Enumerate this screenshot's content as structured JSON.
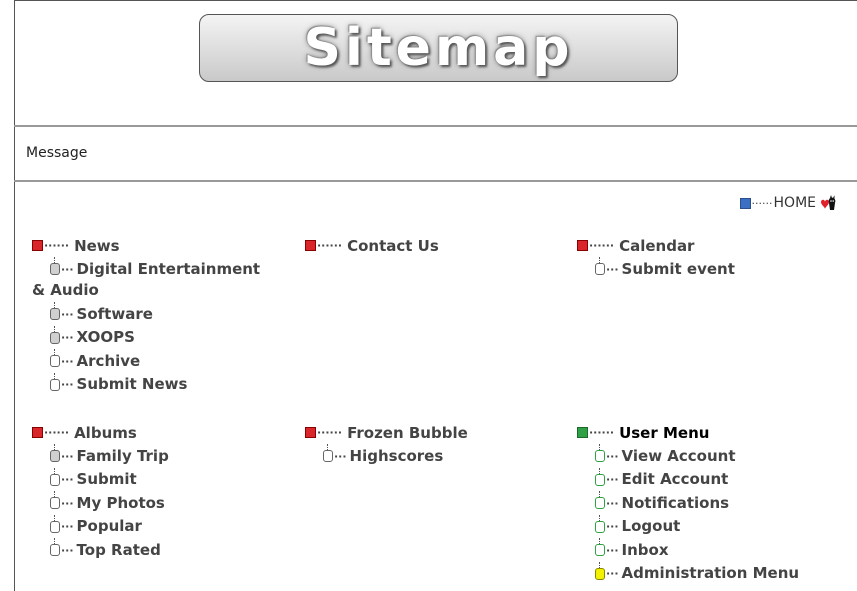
{
  "logo": {
    "text": "Sitemap"
  },
  "message": "Message",
  "home": {
    "label": "HOME",
    "dots": "······"
  },
  "sections": [
    {
      "title": "News",
      "dots": "······",
      "items": [
        "Digital Entertainment & Audio",
        "Software",
        "XOOPS",
        "Archive",
        "Submit News"
      ]
    },
    {
      "title": "Contact Us",
      "dots": "······",
      "items": []
    },
    {
      "title": "Calendar",
      "dots": "······",
      "items": [
        "Submit event"
      ]
    },
    {
      "title": "Albums",
      "dots": "······",
      "items": [
        "Family Trip",
        "Submit",
        "My Photos",
        "Popular",
        "Top Rated"
      ]
    },
    {
      "title": "Frozen Bubble",
      "dots": "······",
      "items": [
        "Highscores"
      ]
    },
    {
      "title": "User Menu",
      "dots": "······",
      "items": [
        "View Account",
        "Edit Account",
        "Notifications",
        "Logout",
        "Inbox",
        "Administration Menu"
      ]
    }
  ],
  "connector": "···",
  "colors": {
    "section_red": "#d9262a",
    "section_green": "#2fa045",
    "home_blue": "#3b6fc4",
    "admin_yellow": "#f2f200"
  }
}
